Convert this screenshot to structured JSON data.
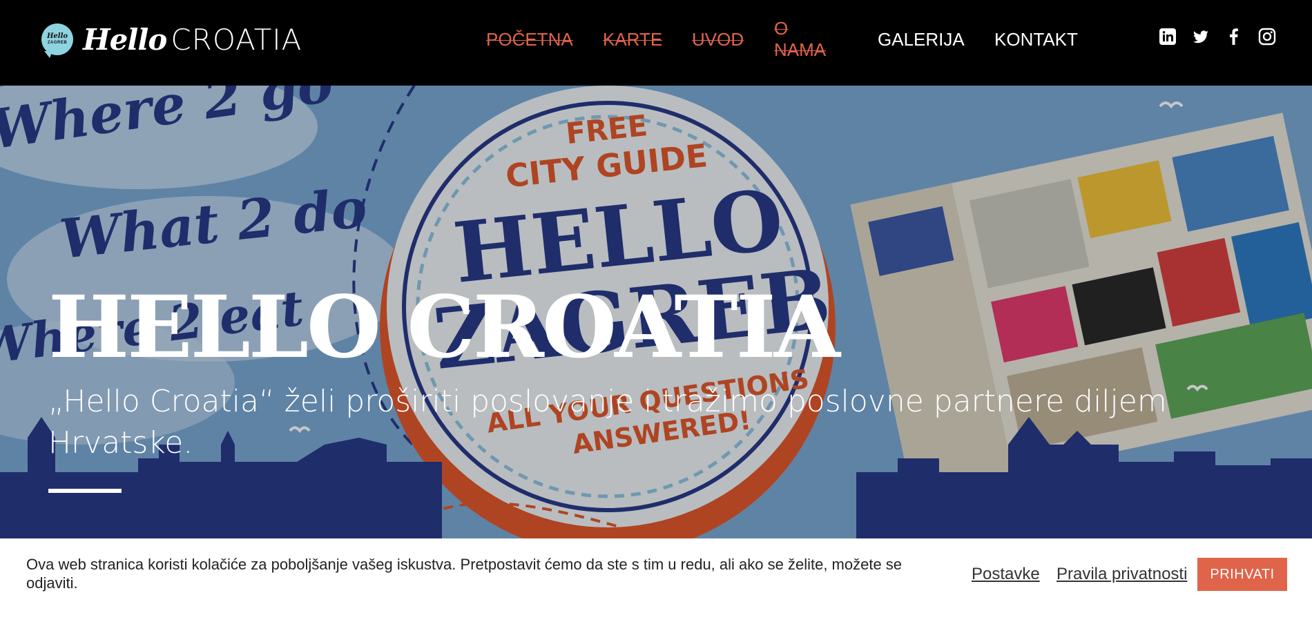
{
  "logo": {
    "badge_line1": "Hello",
    "badge_line2": "ZAGREB",
    "word1": "Hello",
    "word2": "CROATIA"
  },
  "nav": {
    "items": [
      {
        "label": "POČETNA",
        "color": "#e0644a"
      },
      {
        "label": "KARTE",
        "color": "#e0644a"
      },
      {
        "label": "UVOD",
        "color": "#e0644a"
      },
      {
        "label": "O NAMA",
        "color": "#e0644a"
      },
      {
        "label": "GALERIJA",
        "color": "#ffffff"
      },
      {
        "label": "KONTAKT",
        "color": "#ffffff"
      }
    ],
    "social_icons": [
      "linkedin-icon",
      "twitter-icon",
      "facebook-icon",
      "instagram-icon"
    ]
  },
  "hero": {
    "title": "HELLO CROATIA",
    "subtitle": "„Hello Croatia“ želi proširiti poslovanje i tražimo poslovne partnere diljem Hrvatske.",
    "artwork": {
      "script_lines": [
        "Where 2 go",
        "What 2 do",
        "Where 2 eat"
      ],
      "badge_top": "FREE",
      "badge_mid": "CITY GUIDE",
      "badge_main1": "HELLO",
      "badge_main2": "ZAGREB",
      "badge_bottom1": "ALL YOUR QUESTIONS",
      "badge_bottom2": "ANSWERED!"
    }
  },
  "cookie": {
    "text": "Ova web stranica koristi kolačiće za poboljšanje vašeg iskustva. Pretpostavit ćemo da ste s tim u redu, ali ako se želite, možete se odjaviti.",
    "settings_label": "Postavke",
    "privacy_label": "Pravila privatnosti",
    "accept_label": "PRIHVATI"
  },
  "colors": {
    "accent": "#e0644a",
    "navbar": "#000000",
    "navy": "#283a8a",
    "sky": "#6f9ecb"
  }
}
